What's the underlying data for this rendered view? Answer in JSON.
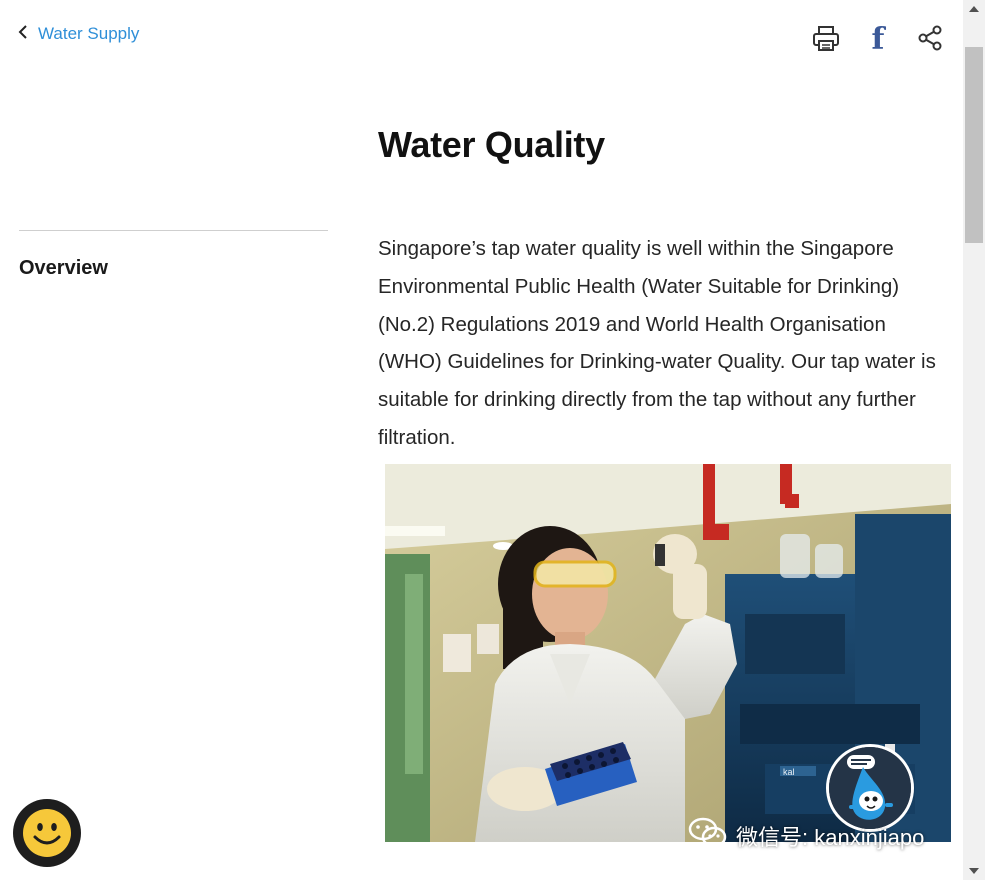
{
  "nav": {
    "back_label": "Water Supply",
    "back_icon": "chevron-left-icon"
  },
  "toolbar": {
    "print_icon": "printer-icon",
    "facebook_glyph": "f",
    "share_icon": "share-icon"
  },
  "page": {
    "title": "Water Quality",
    "body": "Singapore’s tap water quality is well within the Singapore Environmental Public Health (Water Suitable for Drinking) (No.2) Regulations 2019 and World Health Organisation (WHO) Guidelines for Drinking-water Quality. Our tap water is suitable for drinking directly from the tap without any further filtration."
  },
  "sidebar": {
    "items": [
      {
        "label": "Overview"
      }
    ]
  },
  "photo": {
    "instrument_brand_text": "kal"
  },
  "watermark": {
    "text": "微信号: kanxinjiapo"
  },
  "colors": {
    "link": "#2f8fd8",
    "facebook": "#3b5998",
    "title": "#111111",
    "body_text": "#262626"
  }
}
